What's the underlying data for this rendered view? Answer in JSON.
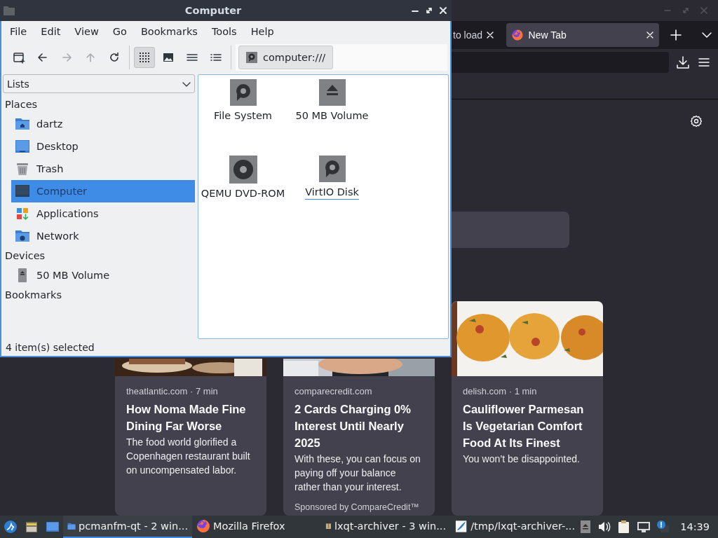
{
  "browser": {
    "tabs": [
      {
        "label": "to load",
        "selected": false
      },
      {
        "label": "New Tab",
        "selected": true
      }
    ],
    "cards": [
      {
        "source": "theatlantic.com · 7 min",
        "title": "How Noma Made Fine Dining Far Worse",
        "description": "The food world glorified a Copenhagen restaurant built on uncompensated labor."
      },
      {
        "source": "comparecredit.com",
        "title": "2 Cards Charging 0% Interest Until Nearly 2025",
        "description": "With these, you can focus on paying off your balance rather than your interest.",
        "sponsor": "Sponsored by CompareCredit™"
      },
      {
        "source": "delish.com · 1 min",
        "title": "Cauliflower Parmesan Is Vegetarian Comfort Food At Its Finest",
        "description": "You won’t be disappointed."
      }
    ]
  },
  "file_manager": {
    "title": "Computer",
    "menu": [
      "File",
      "Edit",
      "View",
      "Go",
      "Bookmarks",
      "Tools",
      "Help"
    ],
    "nav_buttons": [
      {
        "kind": "new-tab",
        "disabled": false
      },
      {
        "kind": "back",
        "disabled": false
      },
      {
        "kind": "forward",
        "disabled": true
      },
      {
        "kind": "up",
        "disabled": true
      },
      {
        "kind": "reload",
        "disabled": false
      }
    ],
    "view_buttons": [
      {
        "kind": "icons",
        "selected": true
      },
      {
        "kind": "thumbnails",
        "selected": false
      },
      {
        "kind": "compact",
        "selected": false
      },
      {
        "kind": "details",
        "selected": false
      }
    ],
    "path": "computer:///",
    "sidebar": {
      "dropdown": "Lists",
      "sections": [
        {
          "heading": "Places",
          "items": [
            {
              "label": "dartz",
              "kind": "home",
              "selected": false
            },
            {
              "label": "Desktop",
              "kind": "desktop",
              "selected": false
            },
            {
              "label": "Trash",
              "kind": "trash",
              "selected": false
            },
            {
              "label": "Computer",
              "kind": "computer",
              "selected": true
            },
            {
              "label": "Applications",
              "kind": "apps",
              "selected": false
            },
            {
              "label": "Network",
              "kind": "network",
              "selected": false
            }
          ]
        },
        {
          "heading": "Devices",
          "items": [
            {
              "label": "50 MB Volume",
              "kind": "drive",
              "selected": false
            }
          ]
        },
        {
          "heading": "Bookmarks"
        }
      ]
    },
    "items": [
      {
        "label": "File System",
        "kind": "disk",
        "focused": false
      },
      {
        "label": "50 MB Volume",
        "kind": "removable",
        "focused": false
      },
      {
        "label": "QEMU DVD-ROM",
        "kind": "optical",
        "focused": false
      },
      {
        "label": "VirtIO Disk",
        "kind": "disk",
        "focused": true
      }
    ],
    "status": "4 item(s) selected"
  },
  "taskbar": {
    "launchers": [
      {
        "kind": "start"
      },
      {
        "kind": "files"
      },
      {
        "kind": "desktop"
      }
    ],
    "tasks": [
      {
        "label": "pcmanfm-qt - 2 win...",
        "kind": "folder",
        "selected": true
      },
      {
        "label": "Mozilla Firefox",
        "kind": "firefox",
        "selected": false
      },
      {
        "label": "lxqt-archiver - 3 win...",
        "kind": "archive",
        "selected": false
      },
      {
        "label": "/tmp/lxqt-archiver-...",
        "kind": "editor",
        "selected": false
      }
    ],
    "tray": [
      {
        "kind": "eject"
      },
      {
        "kind": "volume"
      },
      {
        "kind": "clipboard"
      },
      {
        "kind": "network"
      },
      {
        "kind": "notification"
      }
    ],
    "clock": "14:39"
  }
}
